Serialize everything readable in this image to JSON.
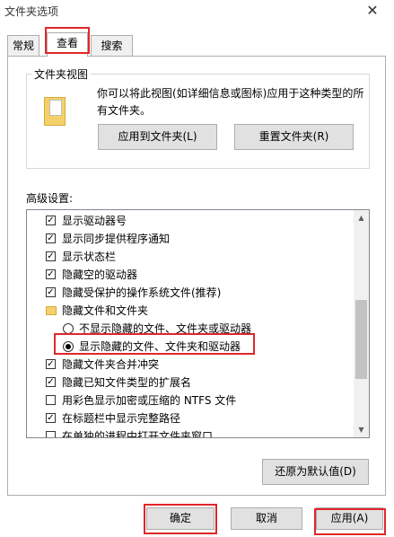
{
  "window": {
    "title": "文件夹选项",
    "close_glyph": "✕"
  },
  "tabs": [
    {
      "label": "常规"
    },
    {
      "label": "查看"
    },
    {
      "label": "搜索"
    }
  ],
  "folder_view": {
    "label": "文件夹视图",
    "description": "你可以将此视图(如详细信息或图标)应用于这种类型的所有文件夹。",
    "apply_button": "应用到文件夹(L)",
    "reset_button": "重置文件夹(R)"
  },
  "advanced": {
    "label": "高级设置:",
    "items": [
      {
        "type": "checkbox",
        "checked": true,
        "label": "显示驱动器号"
      },
      {
        "type": "checkbox",
        "checked": true,
        "label": "显示同步提供程序通知"
      },
      {
        "type": "checkbox",
        "checked": true,
        "label": "显示状态栏"
      },
      {
        "type": "checkbox",
        "checked": true,
        "label": "隐藏空的驱动器"
      },
      {
        "type": "checkbox",
        "checked": true,
        "label": "隐藏受保护的操作系统文件(推荐)"
      },
      {
        "type": "folder",
        "label": "隐藏文件和文件夹"
      },
      {
        "type": "radio",
        "checked": false,
        "label": "不显示隐藏的文件、文件夹或驱动器"
      },
      {
        "type": "radio",
        "checked": true,
        "label": "显示隐藏的文件、文件夹和驱动器"
      },
      {
        "type": "checkbox",
        "checked": true,
        "label": "隐藏文件夹合并冲突"
      },
      {
        "type": "checkbox",
        "checked": true,
        "label": "隐藏已知文件类型的扩展名"
      },
      {
        "type": "checkbox",
        "checked": false,
        "label": "用彩色显示加密或压缩的 NTFS 文件"
      },
      {
        "type": "checkbox",
        "checked": true,
        "label": "在标题栏中显示完整路径"
      },
      {
        "type": "checkbox",
        "checked": false,
        "label": "在单独的进程中打开文件夹窗口"
      }
    ],
    "restore_button": "还原为默认值(D)"
  },
  "footer": {
    "ok_button": "确定",
    "cancel_button": "取消",
    "apply_button": "应用(A)"
  },
  "colors": {
    "highlight": "#e0262a",
    "folder": "#f3d06a"
  }
}
